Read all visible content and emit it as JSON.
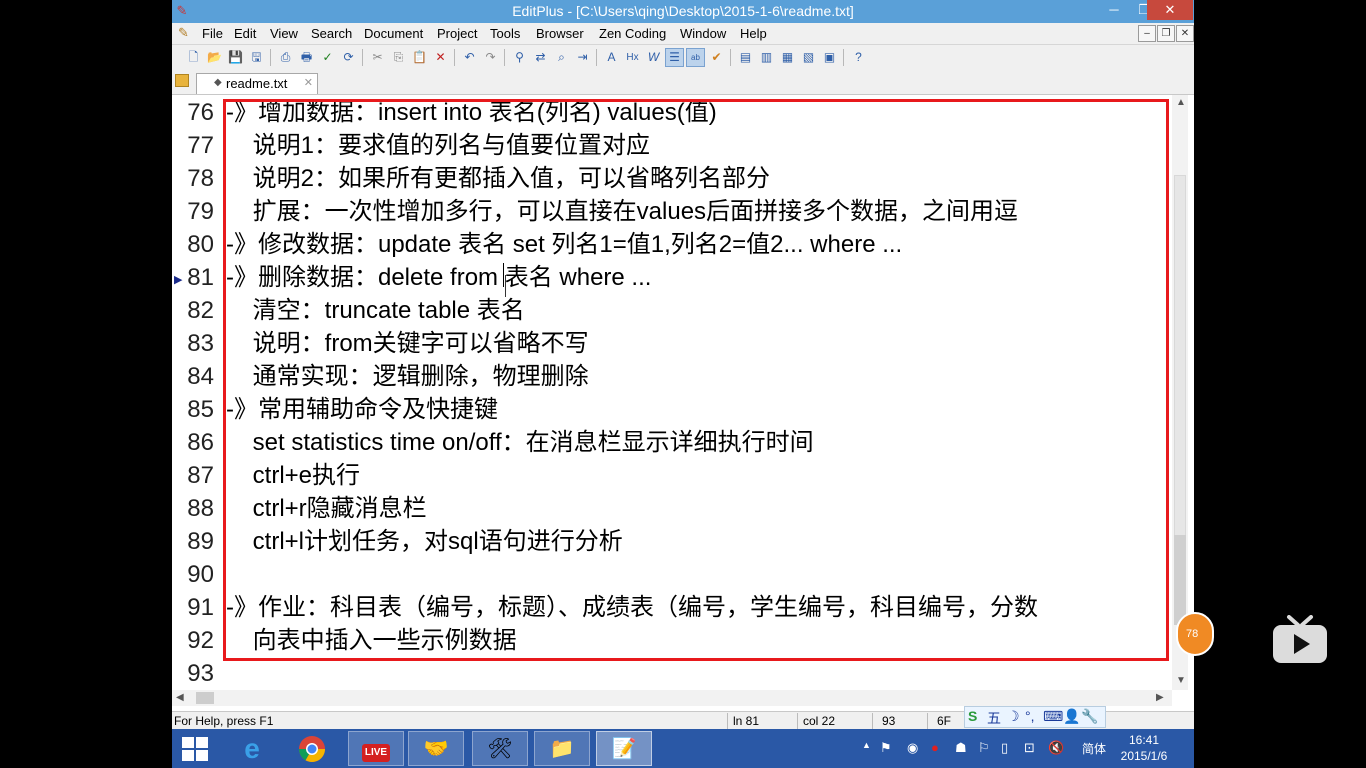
{
  "window": {
    "title": "EditPlus - [C:\\Users\\qing\\Desktop\\2015-1-6\\readme.txt]",
    "minimize": "─",
    "maximize": "❐",
    "close": "✕"
  },
  "menu": {
    "items": [
      "File",
      "Edit",
      "View",
      "Search",
      "Document",
      "Project",
      "Tools",
      "Browser",
      "Zen Coding",
      "Window",
      "Help"
    ],
    "mdi_min": "–",
    "mdi_restore": "❐",
    "mdi_close": "✕"
  },
  "tab": {
    "label": "readme.txt",
    "close": "✕"
  },
  "editor": {
    "lines": [
      {
        "no": "76",
        "text": "-》增加数据：insert into 表名(列名) values(值)"
      },
      {
        "no": "77",
        "text": "    说明1：要求值的列名与值要位置对应"
      },
      {
        "no": "78",
        "text": "    说明2：如果所有更都插入值，可以省略列名部分"
      },
      {
        "no": "79",
        "text": "    扩展：一次性增加多行，可以直接在values后面拼接多个数据，之间用逗"
      },
      {
        "no": "80",
        "text": "-》修改数据：update 表名 set 列名1=值1,列名2=值2... where ..."
      },
      {
        "no": "81",
        "text": "-》删除数据：delete from 表名 where ..."
      },
      {
        "no": "82",
        "text": "    清空：truncate table 表名"
      },
      {
        "no": "83",
        "text": "    说明：from关键字可以省略不写"
      },
      {
        "no": "84",
        "text": "    通常实现：逻辑删除，物理删除"
      },
      {
        "no": "85",
        "text": "-》常用辅助命令及快捷键"
      },
      {
        "no": "86",
        "text": "    set statistics time on/off：在消息栏显示详细执行时间"
      },
      {
        "no": "87",
        "text": "    ctrl+e执行"
      },
      {
        "no": "88",
        "text": "    ctrl+r隐藏消息栏"
      },
      {
        "no": "89",
        "text": "    ctrl+l计划任务，对sql语句进行分析"
      },
      {
        "no": "90",
        "text": ""
      },
      {
        "no": "91",
        "text": "-》作业：科目表（编号，标题）、成绩表（编号，学生编号，科目编号，分数"
      },
      {
        "no": "92",
        "text": "    向表中插入一些示例数据"
      },
      {
        "no": "93",
        "text": ""
      }
    ]
  },
  "status": {
    "help": "For Help, press F1",
    "line": "ln 81",
    "col": "col 22",
    "total": "93",
    "size": "6F",
    "ime_items": [
      "S",
      "五",
      "☽",
      "°,",
      "⌨",
      "👤",
      "🔧"
    ]
  },
  "taskbar": {
    "clock_time": "16:41",
    "clock_date": "2015/1/6",
    "lang": "简体",
    "live_label": "LIVE"
  },
  "overlay": {
    "badge": "78"
  },
  "colors": {
    "titlebar": "#5aa0d8",
    "taskbar": "#2a58a6",
    "highlight_box": "#e8191c"
  }
}
